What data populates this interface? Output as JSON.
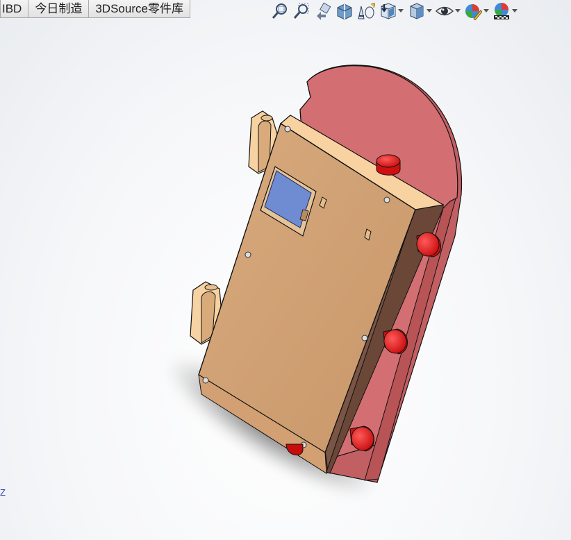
{
  "tabs": [
    "IBD",
    "今日制造",
    "3DSource零件库"
  ],
  "toolbar": {
    "icons": [
      "zoom-to-fit-icon",
      "zoom-to-area-icon",
      "previous-view-icon",
      "section-view-icon",
      "dynamic-annotation-icon",
      "view-orientation-icon",
      "display-style-icon",
      "hide-show-items-icon",
      "edit-appearance-icon",
      "apply-scene-icon"
    ]
  },
  "triad": {
    "axis_label": "Z"
  },
  "colors": {
    "plate": "#d36f72",
    "plate_edge": "#c25f63",
    "box_front": "#cf9f72",
    "box_top": "#f8d2a1",
    "box_side": "#7a5444",
    "screen": "#6f8bd2",
    "knob": "#e01a1a"
  }
}
